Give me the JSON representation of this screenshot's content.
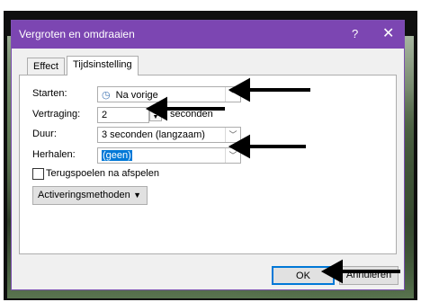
{
  "dialog": {
    "title": "Vergroten en omdraaien",
    "help_label": "?",
    "close_label": "✕"
  },
  "tabs": [
    {
      "label": "Effect"
    },
    {
      "label": "Tijdsinstelling"
    }
  ],
  "fields": {
    "start": {
      "label": "Starten:",
      "value": "Na vorige",
      "icon": "clock-icon"
    },
    "delay": {
      "label": "Vertraging:",
      "value": "2",
      "suffix": "seconden"
    },
    "duration": {
      "label": "Duur:",
      "value": "3 seconden (langzaam)"
    },
    "repeat": {
      "label": "Herhalen:",
      "value": "(geen)"
    }
  },
  "rewind": {
    "label": "Terugspoelen na afspelen",
    "checked": false
  },
  "triggers": {
    "label": "Activeringsmethoden"
  },
  "buttons": {
    "ok": "OK",
    "cancel": "Annuleren"
  }
}
